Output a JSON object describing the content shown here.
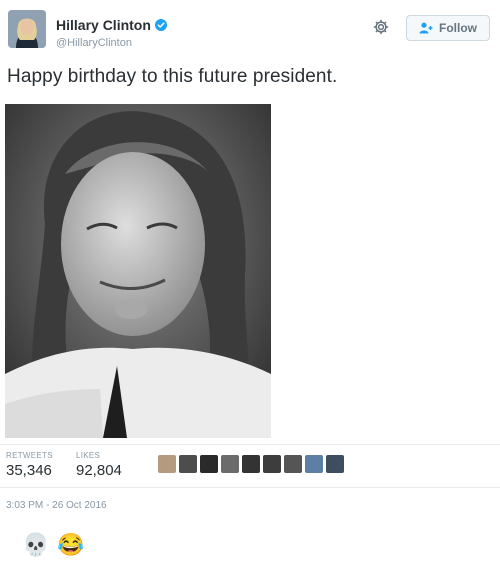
{
  "tweet": {
    "display_name": "Hillary Clinton",
    "handle": "@HillaryClinton",
    "follow_label": "Follow",
    "text": "Happy birthday to this future president.",
    "retweets_label": "RETWEETS",
    "retweets_count": "35,346",
    "likes_label": "LIKES",
    "likes_count": "92,804",
    "timestamp": "3:03 PM - 26 Oct 2016"
  },
  "icons": {
    "verified": "verified-badge-icon",
    "settings": "gear-icon",
    "follow": "add-user-icon"
  },
  "colors": {
    "verified_blue": "#1da1f2",
    "text": "#292f33",
    "muted": "#8899a6"
  },
  "reactions": [
    "💀",
    "😂"
  ]
}
